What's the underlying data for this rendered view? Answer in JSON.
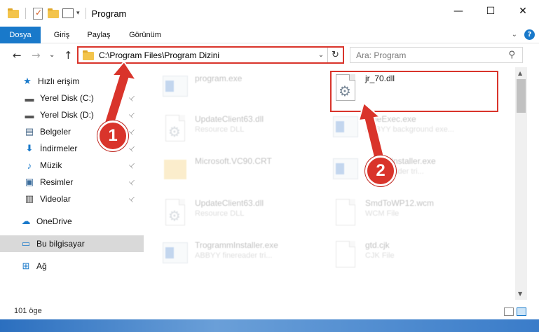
{
  "window": {
    "title": "Program",
    "controls": {
      "minimize": "—",
      "maximize": "☐",
      "close": "✕"
    }
  },
  "ribbon": {
    "tabs": [
      "Dosya",
      "Giriş",
      "Paylaş",
      "Görünüm"
    ],
    "active_tab": "Dosya",
    "help": "?"
  },
  "navigation": {
    "back": "←",
    "forward": "→",
    "history": "⌄",
    "up": "↑",
    "address": "C:\\Program Files\\Program Dizini",
    "refresh": "↻",
    "search_placeholder": "Ara: Program"
  },
  "sidebar": {
    "items": [
      {
        "label": "Hızlı erişim",
        "icon": "star-icon",
        "glyph": "★",
        "color": "#1979ca",
        "pinned": false
      },
      {
        "label": "Yerel Disk (C:)",
        "icon": "drive-icon",
        "glyph": "▬",
        "color": "#555555",
        "pinned": true
      },
      {
        "label": "Yerel Disk (D:)",
        "icon": "drive-icon",
        "glyph": "▬",
        "color": "#555555",
        "pinned": true
      },
      {
        "label": "Belgeler",
        "icon": "documents-icon",
        "glyph": "▤",
        "color": "#4a6a8a",
        "pinned": true
      },
      {
        "label": "İndirmeler",
        "icon": "download-icon",
        "glyph": "⬇",
        "color": "#1979ca",
        "pinned": true
      },
      {
        "label": "Müzik",
        "icon": "music-icon",
        "glyph": "♪",
        "color": "#1979ca",
        "pinned": true
      },
      {
        "label": "Resimler",
        "icon": "pictures-icon",
        "glyph": "▣",
        "color": "#3c6d9c",
        "pinned": true
      },
      {
        "label": "Videolar",
        "icon": "video-icon",
        "glyph": "▥",
        "color": "#333333",
        "pinned": true
      },
      {
        "label": "OneDrive",
        "icon": "cloud-icon",
        "glyph": "☁",
        "color": "#1979ca",
        "pinned": false
      },
      {
        "label": "Bu bilgisayar",
        "icon": "computer-icon",
        "glyph": "▭",
        "color": "#1979ca",
        "pinned": false
      },
      {
        "label": "Ağ",
        "icon": "network-icon",
        "glyph": "⊞",
        "color": "#1979ca",
        "pinned": false
      }
    ],
    "pin_glyph": "📌"
  },
  "files": [
    {
      "name": "program.exe",
      "desc": "",
      "faded": true,
      "type": "exe"
    },
    {
      "name": "jr_70.dll",
      "desc": "",
      "faded": false,
      "type": "dll"
    },
    {
      "name": "UpdateClient63.dll",
      "desc": "Resource DLL",
      "faded": true,
      "type": "dll"
    },
    {
      "name": "...neExec.exe",
      "desc": "ABBYY background exe...",
      "faded": true,
      "type": "exe"
    },
    {
      "name": "Microsoft.VC90.CRT",
      "desc": "",
      "faded": true,
      "type": "folder"
    },
    {
      "name": "...ammInstaller.exe",
      "desc": "...Finereader tri...",
      "faded": true,
      "type": "exe"
    },
    {
      "name": "UpdateClient63.dll",
      "desc": "Resource DLL",
      "faded": true,
      "type": "dll"
    },
    {
      "name": "SmdToWP12.wcm",
      "desc": "WCM File",
      "faded": true,
      "type": "doc"
    },
    {
      "name": "TrogrammInstaller.exe",
      "desc": "ABBYY finereader tri...",
      "faded": true,
      "type": "exe"
    },
    {
      "name": "gtd.cjk",
      "desc": "CJK File",
      "faded": true,
      "type": "doc"
    }
  ],
  "status": {
    "item_count": "101 öge"
  },
  "annotations": {
    "step1": "1",
    "step2": "2",
    "accent_color": "#d9342b"
  }
}
